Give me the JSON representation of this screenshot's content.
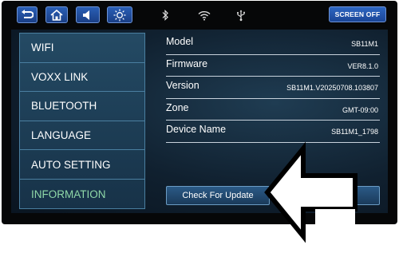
{
  "topbar": {
    "screen_off_label": "SCREEN OFF",
    "buttons": [
      "back-icon",
      "home-icon",
      "speaker-icon",
      "brightness-icon"
    ],
    "status_icons": [
      "bluetooth-icon",
      "wifi-icon",
      "usb-icon"
    ]
  },
  "sidebar": {
    "items": [
      {
        "label": "WIFI"
      },
      {
        "label": "VOXX LINK"
      },
      {
        "label": "BLUETOOTH"
      },
      {
        "label": "LANGUAGE"
      },
      {
        "label": "AUTO SETTING"
      },
      {
        "label": "INFORMATION",
        "active": true
      }
    ]
  },
  "info": {
    "rows": [
      {
        "label": "Model",
        "value": "SB11M1"
      },
      {
        "label": "Firmware",
        "value": "VER8.1.0"
      },
      {
        "label": "Version",
        "value": "SB11M1.V20250708.103807"
      },
      {
        "label": "Zone",
        "value": "GMT-09:00"
      },
      {
        "label": "Device Name",
        "value": "SB11M1_1798"
      }
    ]
  },
  "update_button_label": "Check For Update",
  "colors": {
    "accent_blue": "#1a4596",
    "active_menu_text": "#8fd8a8",
    "panel_border": "#4a7fa0"
  }
}
